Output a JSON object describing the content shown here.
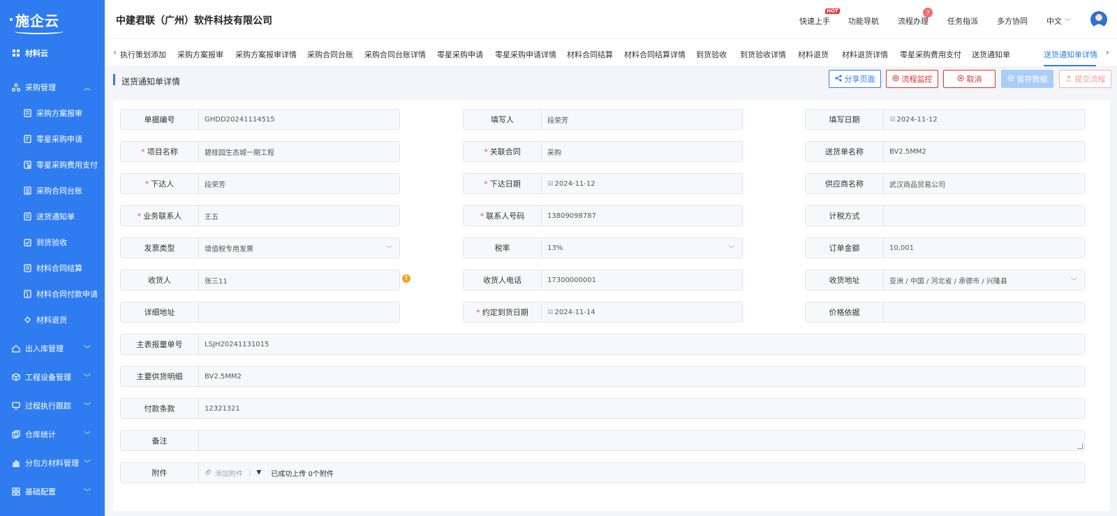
{
  "sidebar": {
    "logo": "施企云",
    "top_item": "材料云",
    "items": [
      {
        "label": "采购管理",
        "expanded": true
      },
      {
        "label": "采购方案报审"
      },
      {
        "label": "零星采购申请"
      },
      {
        "label": "零星采购费用支付"
      },
      {
        "label": "采购合同台账"
      },
      {
        "label": "送货通知单"
      },
      {
        "label": "到货验收"
      },
      {
        "label": "材料合同结算"
      },
      {
        "label": "材料合同付款申请"
      },
      {
        "label": "材料退货"
      },
      {
        "label": "出入库管理"
      },
      {
        "label": "工程设备管理"
      },
      {
        "label": "过程执行跟踪"
      },
      {
        "label": "仓库统计"
      },
      {
        "label": "分包方材料管理"
      },
      {
        "label": "基础配置"
      }
    ]
  },
  "header": {
    "company": "中建君联（广州）软件科技有限公司",
    "nav": [
      "快速上手",
      "功能导航",
      "流程办理",
      "任务指派",
      "多方协同",
      "中文"
    ],
    "hot_badge": "HOT",
    "process_count": "7"
  },
  "tabs": {
    "items": [
      "执行策划添加",
      "采购方案报审",
      "采购方案报审详情",
      "采购合同台账",
      "采购合同台账详情",
      "零星采购申请",
      "零星采购申请详情",
      "材料合同结算",
      "材料合同结算详情",
      "到货验收",
      "到货验收详情",
      "材料退货",
      "材料退货详情",
      "零星采购费用支付",
      "送货通知单",
      "送货通知单详情"
    ],
    "active": "送货通知单详情"
  },
  "page": {
    "title": "送货通知单详情",
    "buttons": {
      "share": "分享页面",
      "monitor": "流程监控",
      "cancel": "取消",
      "save": "暂存数据",
      "submit": "提交流程"
    }
  },
  "form": {
    "doc_no": {
      "label": "单据编号",
      "value": "GHDD20241114515"
    },
    "filler": {
      "label": "填写人",
      "value": "段荣芳"
    },
    "fill_date": {
      "label": "填写日期",
      "value": "2024-11-12"
    },
    "project": {
      "label": "项目名称",
      "value": "碧桂园生态城一期工程",
      "required": "*"
    },
    "contract": {
      "label": "关联合同",
      "value": "采购",
      "required": "*"
    },
    "delivery_name": {
      "label": "送货单名称",
      "value": "BV2.5MM2"
    },
    "issuer": {
      "label": "下达人",
      "value": "段荣芳",
      "required": "*"
    },
    "issue_date": {
      "label": "下达日期",
      "value": "2024-11-12",
      "required": "*"
    },
    "supplier": {
      "label": "供应商名称",
      "value": "武汉商品贸易公司"
    },
    "contact": {
      "label": "业务联系人",
      "value": "王五",
      "required": "*"
    },
    "contact_phone": {
      "label": "联系人号码",
      "value": "13809098787",
      "required": "*"
    },
    "tax_method": {
      "label": "计税方式",
      "value": ""
    },
    "invoice_type": {
      "label": "发票类型",
      "value": "增值税专用发票"
    },
    "tax_rate": {
      "label": "税率",
      "value": "13%"
    },
    "order_amount": {
      "label": "订单金额",
      "value": "10,001"
    },
    "receiver": {
      "label": "收货人",
      "value": "张三11"
    },
    "receiver_phone": {
      "label": "收货人电话",
      "value": "17300000001"
    },
    "receive_addr": {
      "label": "收货地址",
      "value": "亚洲 / 中国 / 河北省 / 承德市 / 兴隆县"
    },
    "detail_addr": {
      "label": "详细地址",
      "value": ""
    },
    "agreed_date": {
      "label": "约定到货日期",
      "value": "2024-11-14",
      "required": "*"
    },
    "price_basis": {
      "label": "价格依据",
      "value": ""
    },
    "main_list": {
      "label": "主表报量单号",
      "value": "LSJH20241131015"
    },
    "main_detail": {
      "label": "主要供货明细",
      "value": "BV2.5MM2"
    },
    "payment": {
      "label": "付款条款",
      "value": "12321321"
    },
    "remark": {
      "label": "备注",
      "value": ""
    },
    "attachment": {
      "label": "附件",
      "add": "添加附件",
      "status": "已成功上传 0个附件"
    }
  },
  "colors": {
    "primary": "#2f7cf0",
    "danger": "#d9332f",
    "warning": "#f0a623"
  }
}
